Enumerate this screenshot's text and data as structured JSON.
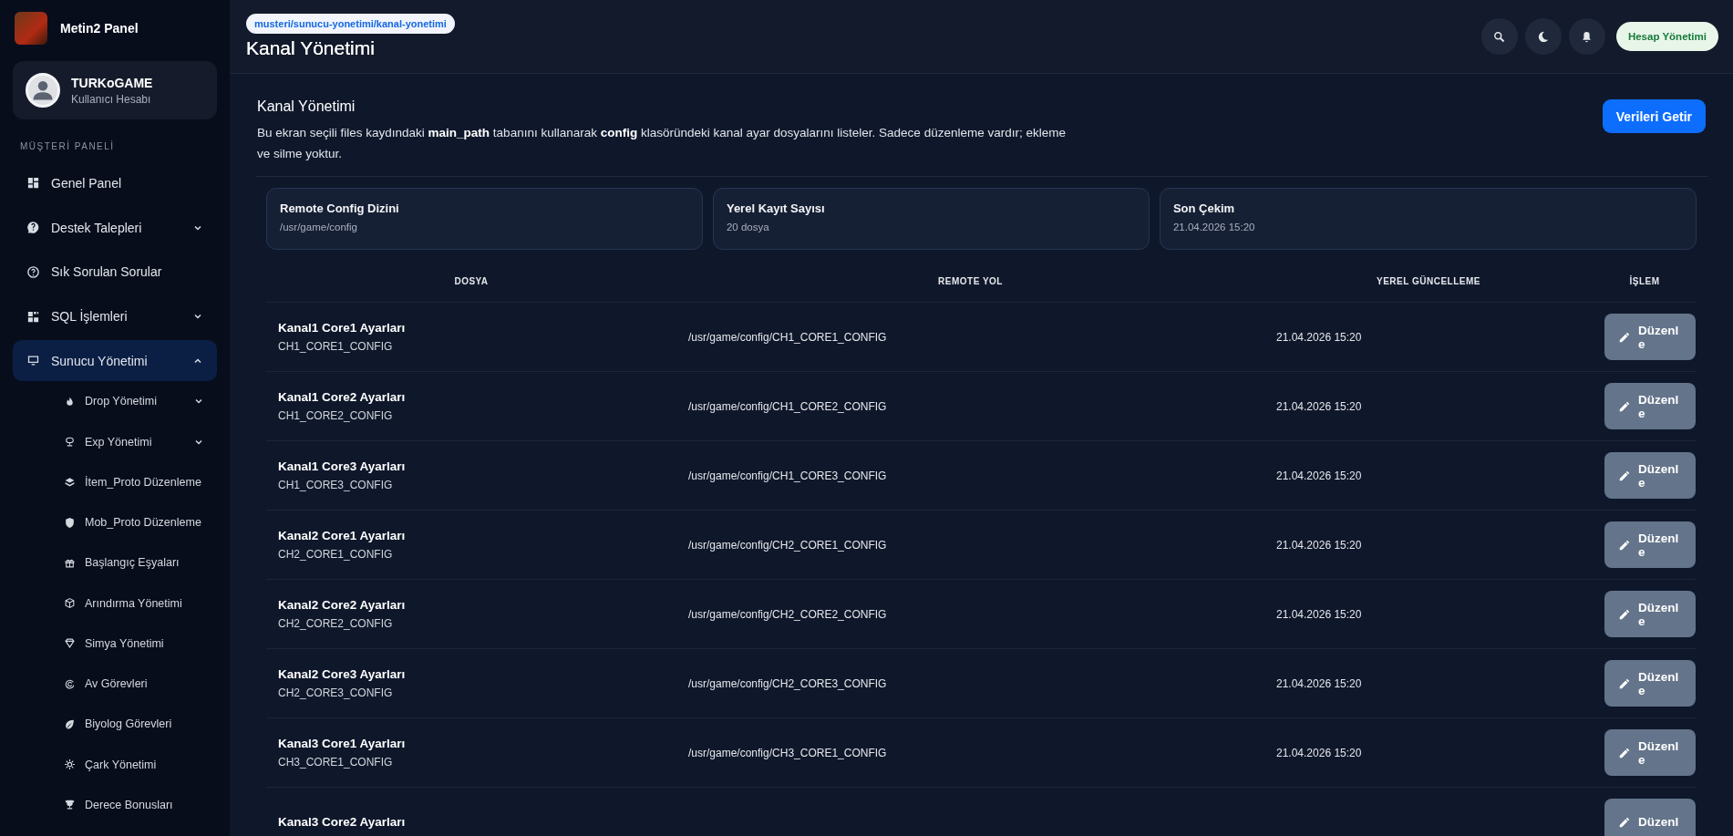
{
  "brand": {
    "title": "Metin2 Panel"
  },
  "user": {
    "name": "TURKoGAME",
    "role": "Kullanıcı Hesabı"
  },
  "sidebar": {
    "section_label": "MÜŞTERİ PANELİ",
    "items": [
      {
        "label": "Genel Panel",
        "selected": false
      },
      {
        "label": "Destek Talepleri",
        "selected": false,
        "expanded": false
      },
      {
        "label": "Sık Sorulan Sorular",
        "selected": false
      },
      {
        "label": "SQL İşlemleri",
        "selected": false,
        "expanded": false
      },
      {
        "label": "Sunucu Yönetimi",
        "selected": true,
        "expanded": true,
        "children": [
          {
            "label": "Drop Yönetimi",
            "selected": false,
            "expanded": false
          },
          {
            "label": "Exp Yönetimi",
            "selected": false,
            "expanded": false
          },
          {
            "label": "İtem_Proto Düzenleme",
            "selected": false
          },
          {
            "label": "Mob_Proto Düzenleme",
            "selected": false
          },
          {
            "label": "Başlangıç Eşyaları",
            "selected": false
          },
          {
            "label": "Arındırma Yönetimi",
            "selected": false
          },
          {
            "label": "Simya Yönetimi",
            "selected": false
          },
          {
            "label": "Av Görevleri",
            "selected": false
          },
          {
            "label": "Biyolog Görevleri",
            "selected": false
          },
          {
            "label": "Çark Yönetimi",
            "selected": false
          },
          {
            "label": "Derece Bonusları",
            "selected": false
          }
        ]
      }
    ]
  },
  "header": {
    "breadcrumb": "musteri/sunucu-yonetimi/kanal-yonetimi",
    "title": "Kanal Yönetimi",
    "account_button": "Hesap Yönetimi"
  },
  "panel": {
    "title": "Kanal Yönetimi",
    "description": "Bu ekran seçili files kaydındaki **main_path** tabanını kullanarak **config** klasöründeki kanal ayar dosyalarını listeler. Sadece düzenleme vardır; ekleme ve silme yoktur.",
    "fetch_button": "Verileri Getir"
  },
  "stats": [
    {
      "label": "Remote Config Dizini",
      "value": "/usr/game/config"
    },
    {
      "label": "Yerel Kayıt Sayısı",
      "value": "20 dosya"
    },
    {
      "label": "Son Çekim",
      "value": "21.04.2026 15:20"
    }
  ],
  "table": {
    "columns": [
      "DOSYA",
      "REMOTE YOL",
      "YEREL GÜNCELLEME",
      "İŞLEM"
    ],
    "rows": [
      {
        "name": "Kanal1 Core1 Ayarları",
        "file": "CH1_CORE1_CONFIG",
        "path": "/usr/game/config/CH1_CORE1_CONFIG",
        "updated": "21.04.2026 15:20",
        "action": "Düzenle"
      },
      {
        "name": "Kanal1 Core2 Ayarları",
        "file": "CH1_CORE2_CONFIG",
        "path": "/usr/game/config/CH1_CORE2_CONFIG",
        "updated": "21.04.2026 15:20",
        "action": "Düzenle"
      },
      {
        "name": "Kanal1 Core3 Ayarları",
        "file": "CH1_CORE3_CONFIG",
        "path": "/usr/game/config/CH1_CORE3_CONFIG",
        "updated": "21.04.2026 15:20",
        "action": "Düzenle"
      },
      {
        "name": "Kanal2 Core1 Ayarları",
        "file": "CH2_CORE1_CONFIG",
        "path": "/usr/game/config/CH2_CORE1_CONFIG",
        "updated": "21.04.2026 15:20",
        "action": "Düzenle"
      },
      {
        "name": "Kanal2 Core2 Ayarları",
        "file": "CH2_CORE2_CONFIG",
        "path": "/usr/game/config/CH2_CORE2_CONFIG",
        "updated": "21.04.2026 15:20",
        "action": "Düzenle"
      },
      {
        "name": "Kanal2 Core3 Ayarları",
        "file": "CH2_CORE3_CONFIG",
        "path": "/usr/game/config/CH2_CORE3_CONFIG",
        "updated": "21.04.2026 15:20",
        "action": "Düzenle"
      },
      {
        "name": "Kanal3 Core1 Ayarları",
        "file": "CH3_CORE1_CONFIG",
        "path": "/usr/game/config/CH3_CORE1_CONFIG",
        "updated": "21.04.2026 15:20",
        "action": "Düzenle"
      },
      {
        "name": "Kanal3 Core2 Ayarları",
        "action": "Düzenl"
      }
    ]
  }
}
